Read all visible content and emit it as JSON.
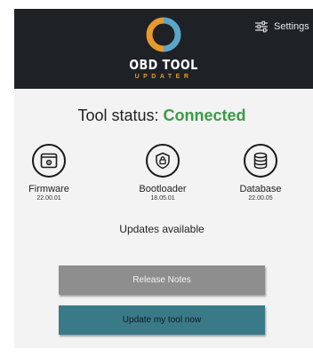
{
  "header": {
    "title": "OBD TOOL",
    "subtitle": "UPDATER",
    "settings_label": "Settings",
    "colors": {
      "background": "#1e2126",
      "logo_orange": "#e79a2a",
      "logo_blue": "#5aa6c8"
    }
  },
  "status": {
    "label": "Tool status:",
    "value": "Connected",
    "value_color": "#3b9a48"
  },
  "components": [
    {
      "name": "Firmware",
      "version": "22.00.01",
      "icon": "firmware-window-gear-icon"
    },
    {
      "name": "Bootloader",
      "version": "18.05.01",
      "icon": "shield-lock-icon"
    },
    {
      "name": "Database",
      "version": "22.00.05",
      "icon": "database-icon"
    }
  ],
  "updates_text": "Updates available",
  "buttons": {
    "release_notes": "Release Notes",
    "update": "Update my tool now",
    "release_notes_color": "#8e8e8e",
    "update_color": "#3a7a88"
  }
}
